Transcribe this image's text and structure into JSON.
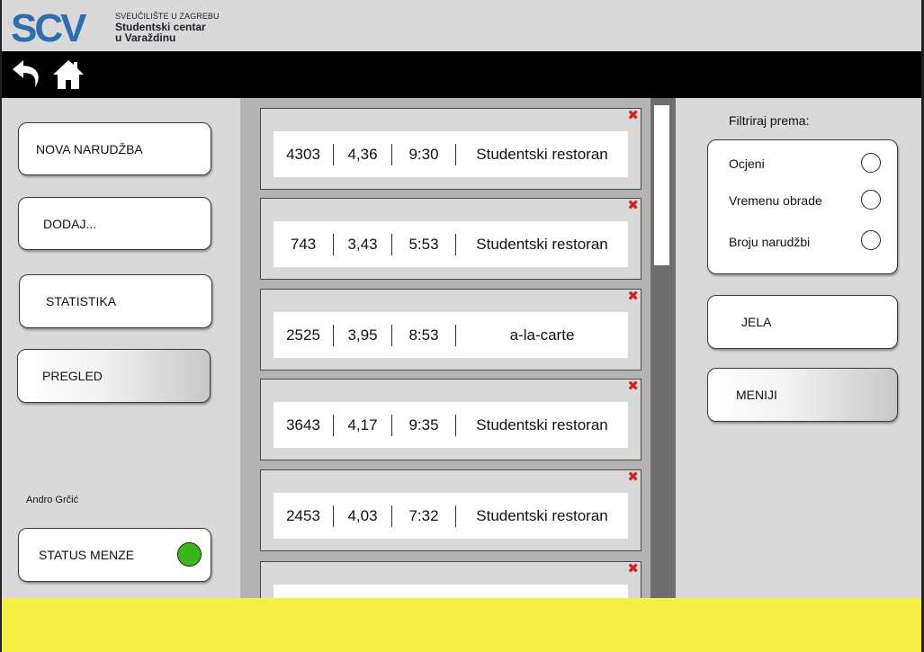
{
  "header": {
    "logo_mark": "SCV",
    "logo_line1": "SVEUČILIŠTE U ZAGREBU",
    "logo_line2": "Studentski centar",
    "logo_line3": "u Varaždinu",
    "brand_color": "#2f6db0"
  },
  "nav": {
    "back_icon": "back-arrow-icon",
    "home_icon": "home-icon"
  },
  "left_menu": {
    "new_order": "NOVA NARUDŽBA",
    "add": "DODAJ...",
    "stats": "STATISTIKA",
    "overview": "PREGLED"
  },
  "user": {
    "name": "Andro Grčić"
  },
  "status": {
    "label": "STATUS MENZE",
    "indicator_color": "#3bb61a"
  },
  "orders": [
    {
      "id": "4303",
      "rating": "4,36",
      "time": "9:30",
      "place": "Studentski restoran"
    },
    {
      "id": "743",
      "rating": "3,43",
      "time": "5:53",
      "place": "Studentski restoran"
    },
    {
      "id": "2525",
      "rating": "3,95",
      "time": "8:53",
      "place": "a-la-carte"
    },
    {
      "id": "3643",
      "rating": "4,17",
      "time": "9:35",
      "place": "Studentski restoran"
    },
    {
      "id": "2453",
      "rating": "4,03",
      "time": "7:32",
      "place": "Studentski restoran"
    }
  ],
  "remove_symbol": "✖",
  "filter": {
    "title": "Filtriraj prema:",
    "options": [
      "Ocjeni",
      "Vremenu obrade",
      "Broju narudžbi"
    ]
  },
  "right_menu": {
    "dishes": "JELA",
    "menus": "MENIJI"
  },
  "footer": {
    "bar_color": "#f6ef45"
  }
}
